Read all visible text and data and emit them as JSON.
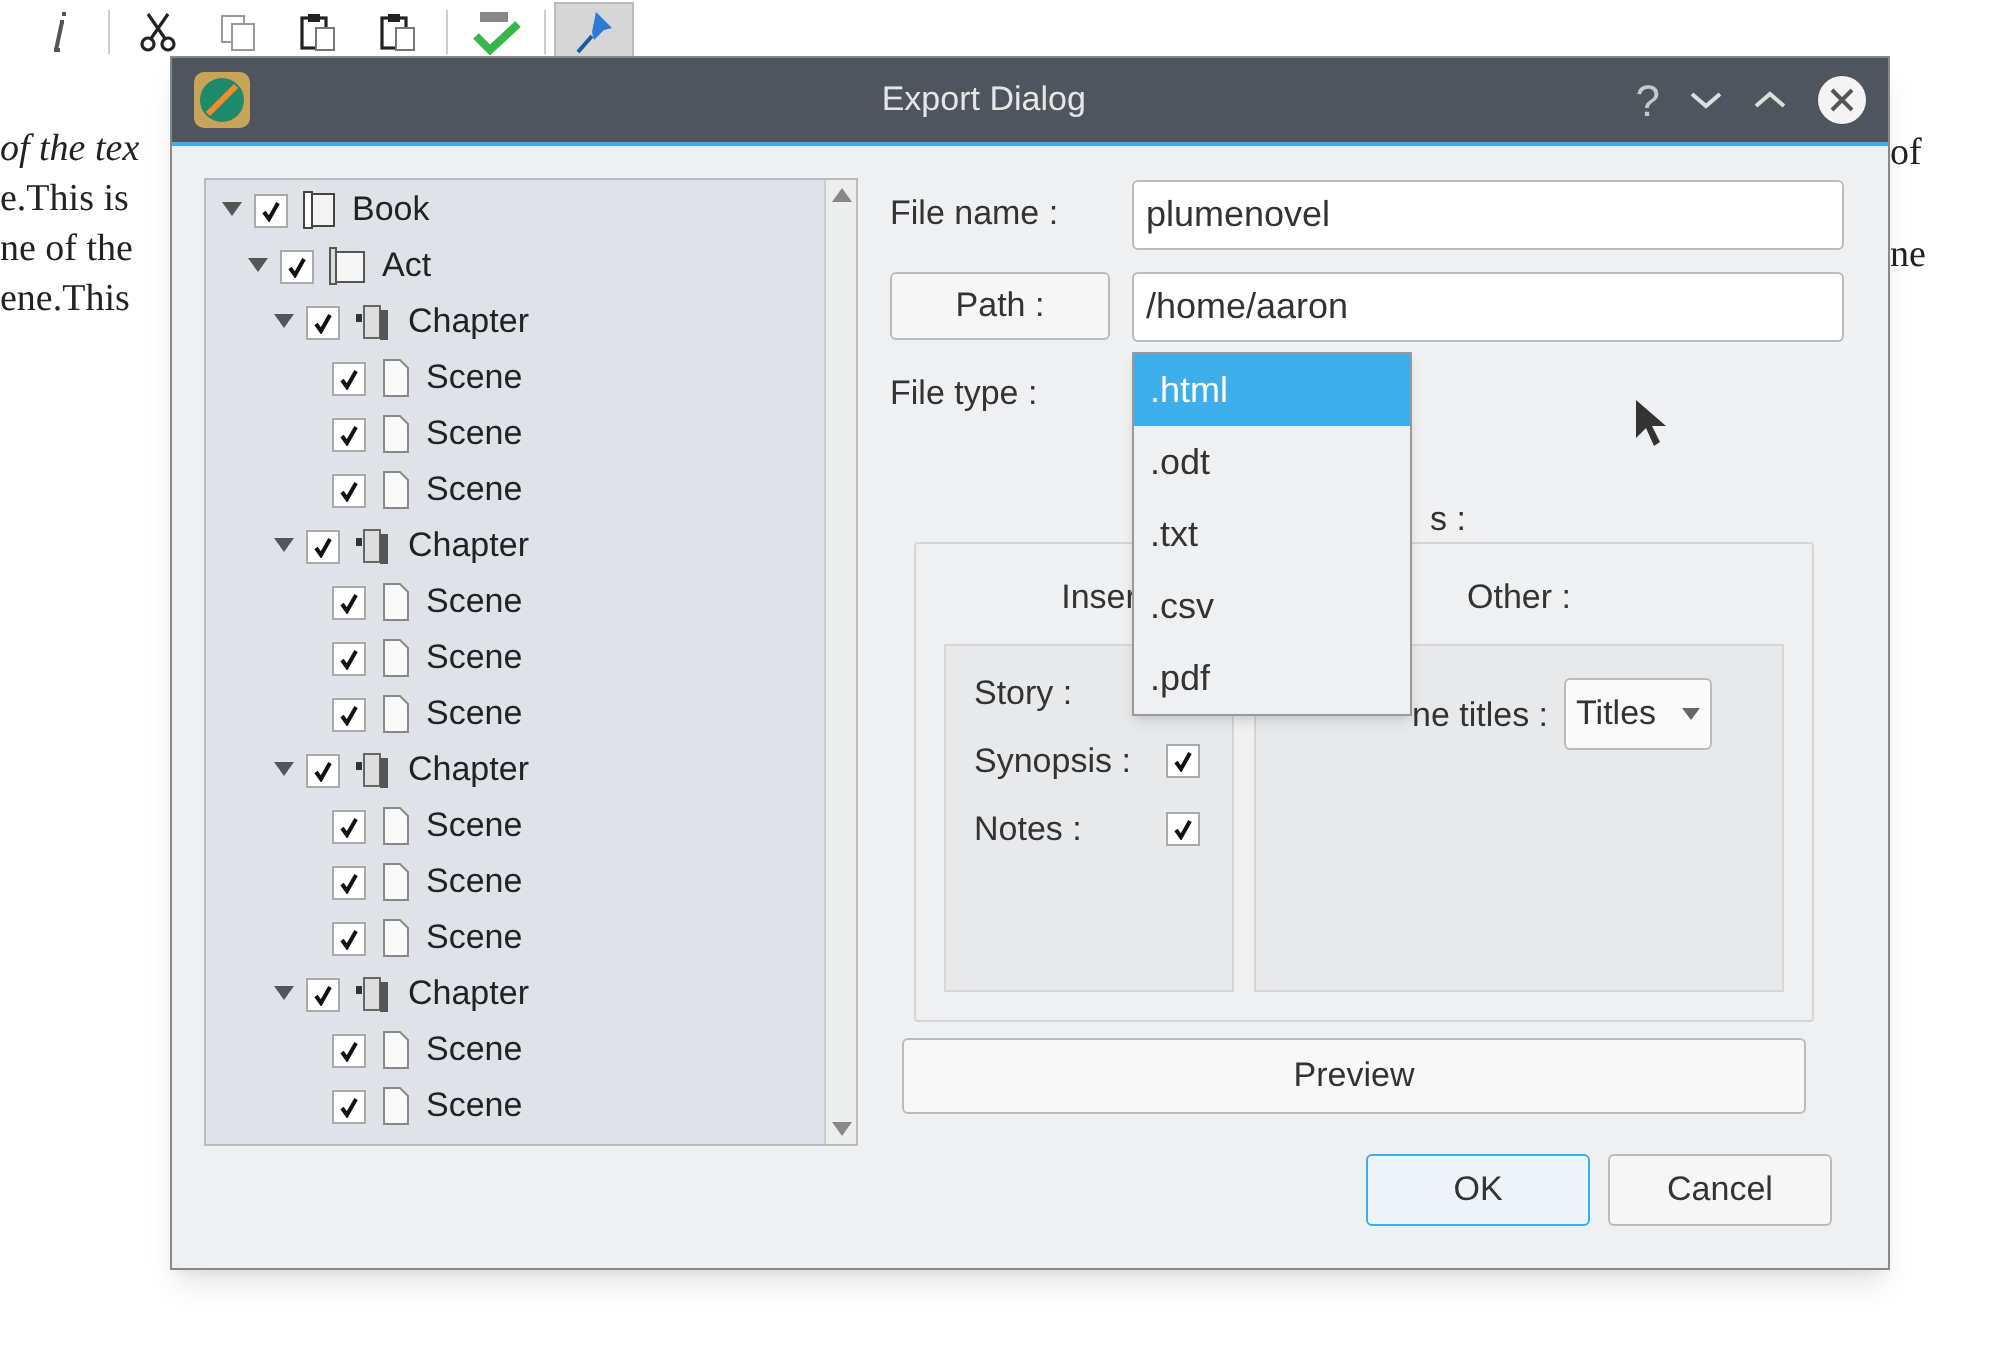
{
  "toolbar": {
    "buttons": [
      {
        "kind": "italic",
        "selected": false
      },
      {
        "kind": "cut",
        "selected": false
      },
      {
        "kind": "copy",
        "selected": false
      },
      {
        "kind": "paste",
        "selected": false
      },
      {
        "kind": "paste",
        "selected": false
      },
      {
        "kind": "spellcheck",
        "selected": false
      },
      {
        "kind": "pin",
        "selected": true
      }
    ]
  },
  "document": {
    "left_lines": [
      {
        "text": "of the tex",
        "italic": true
      },
      {
        "text": "e.This is",
        "italic": false
      },
      {
        "text": "ne of the",
        "italic": false
      },
      {
        "text": "ene.This",
        "italic": false
      }
    ],
    "right_lines": [
      "of",
      "ne"
    ]
  },
  "dialog": {
    "title": "Export Dialog",
    "help": "?",
    "tree": [
      {
        "label": "Book",
        "kind": "book",
        "checked": true,
        "expanded": true,
        "children": [
          {
            "label": "Act",
            "kind": "act",
            "checked": true,
            "expanded": true,
            "children": [
              {
                "label": "Chapter",
                "kind": "chapter",
                "checked": true,
                "expanded": true,
                "children": [
                  {
                    "label": "Scene",
                    "kind": "scene",
                    "checked": true
                  },
                  {
                    "label": "Scene",
                    "kind": "scene",
                    "checked": true
                  },
                  {
                    "label": "Scene",
                    "kind": "scene",
                    "checked": true
                  }
                ]
              },
              {
                "label": "Chapter",
                "kind": "chapter",
                "checked": true,
                "expanded": true,
                "children": [
                  {
                    "label": "Scene",
                    "kind": "scene",
                    "checked": true
                  },
                  {
                    "label": "Scene",
                    "kind": "scene",
                    "checked": true
                  },
                  {
                    "label": "Scene",
                    "kind": "scene",
                    "checked": true
                  }
                ]
              },
              {
                "label": "Chapter",
                "kind": "chapter",
                "checked": true,
                "expanded": true,
                "children": [
                  {
                    "label": "Scene",
                    "kind": "scene",
                    "checked": true
                  },
                  {
                    "label": "Scene",
                    "kind": "scene",
                    "checked": true
                  },
                  {
                    "label": "Scene",
                    "kind": "scene",
                    "checked": true
                  }
                ]
              },
              {
                "label": "Chapter",
                "kind": "chapter",
                "checked": true,
                "expanded": true,
                "children": [
                  {
                    "label": "Scene",
                    "kind": "scene",
                    "checked": true
                  },
                  {
                    "label": "Scene",
                    "kind": "scene",
                    "checked": true
                  }
                ]
              }
            ]
          }
        ]
      }
    ],
    "file_name": {
      "label": "File name :",
      "value": "plumenovel"
    },
    "path": {
      "button": "Path :",
      "value": "/home/aaron"
    },
    "file_type": {
      "label": "File type :",
      "options": [
        {
          "label": ".html",
          "selected": true
        },
        {
          "label": ".odt",
          "selected": false
        },
        {
          "label": ".txt",
          "selected": false
        },
        {
          "label": ".csv",
          "selected": false
        },
        {
          "label": ".pdf",
          "selected": false
        }
      ]
    },
    "options_group": {
      "title": "s :",
      "insert": {
        "title": "Inser",
        "items": [
          {
            "label": "Story :"
          },
          {
            "label": "Synopsis :",
            "checked": true
          },
          {
            "label": "Notes :",
            "checked": true
          }
        ]
      },
      "other": {
        "title": "Other :",
        "scene_titles": {
          "label": "ne titles :",
          "value": "Titles"
        }
      }
    },
    "preview": "Preview",
    "ok": "OK",
    "cancel": "Cancel"
  }
}
